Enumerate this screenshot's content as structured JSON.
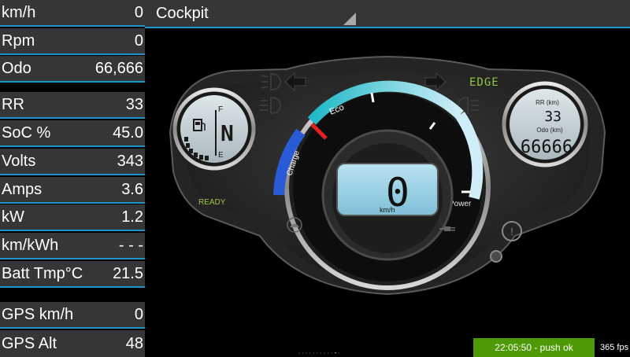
{
  "header": {
    "title": "Cockpit"
  },
  "readouts": [
    {
      "label": "km/h",
      "value": "0"
    },
    {
      "label": "Rpm",
      "value": "0"
    },
    {
      "label": "Odo",
      "value": "66,666"
    },
    {
      "label": "RR",
      "value": "33"
    },
    {
      "label": "SoC %",
      "value": "45.0"
    },
    {
      "label": "Volts",
      "value": "343"
    },
    {
      "label": "Amps",
      "value": "3.6"
    },
    {
      "label": "kW",
      "value": "1.2"
    },
    {
      "label": "km/kWh",
      "value": "- - -"
    },
    {
      "label": "Batt Tmp°C",
      "value": "21.5"
    },
    {
      "label": "GPS km/h",
      "value": "0"
    },
    {
      "label": "GPS Alt",
      "value": "48"
    }
  ],
  "dashboard": {
    "ready_label": "READY",
    "eco_label": "Eco",
    "charge_label": "Charge",
    "power_label": "Power",
    "gear": "N",
    "fuel_f": "F",
    "fuel_e": "E",
    "speed_value": "0",
    "speed_unit": "km/h",
    "range_label": "RR (km)",
    "range_value": "33",
    "odo_label": "Odo (km)",
    "odo_value": "66666",
    "edge_label": "EDGE"
  },
  "status": {
    "message": "22:05:50 - push ok",
    "fps": "365 fps"
  },
  "pager": {
    "dots": "··········•·"
  },
  "colors": {
    "accent_line": "#1c96c8",
    "status_green": "#4e9a06",
    "ready_green": "#a4c640",
    "edge_green": "#8ec63f",
    "eco_teal": "#1fb8c8",
    "charge_blue": "#2a5bd7",
    "needle_red": "#e32222"
  }
}
